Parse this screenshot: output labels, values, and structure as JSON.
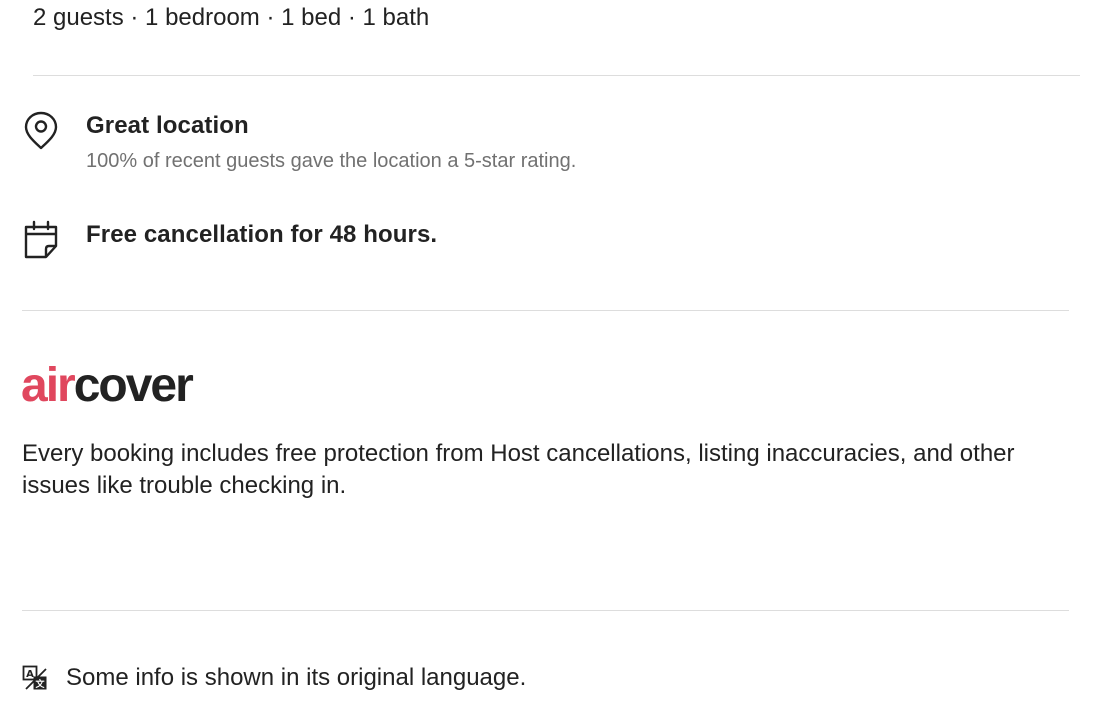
{
  "summary": "2 guests · 1 bedroom · 1 bed · 1 bath",
  "highlights": [
    {
      "icon": "map-pin-icon",
      "title": "Great location",
      "subtitle": "100% of recent guests gave the location a 5-star rating."
    },
    {
      "icon": "calendar-icon",
      "title": "Free cancellation for 48 hours.",
      "subtitle": ""
    }
  ],
  "aircover": {
    "logo_air": "air",
    "logo_cover": "cover",
    "air_color": "#e0475e",
    "description": "Every booking includes free protection from Host cancellations, listing inaccuracies, and other issues like trouble checking in."
  },
  "translation_note": {
    "icon": "translate-icon",
    "text": "Some info is shown in its original language."
  }
}
